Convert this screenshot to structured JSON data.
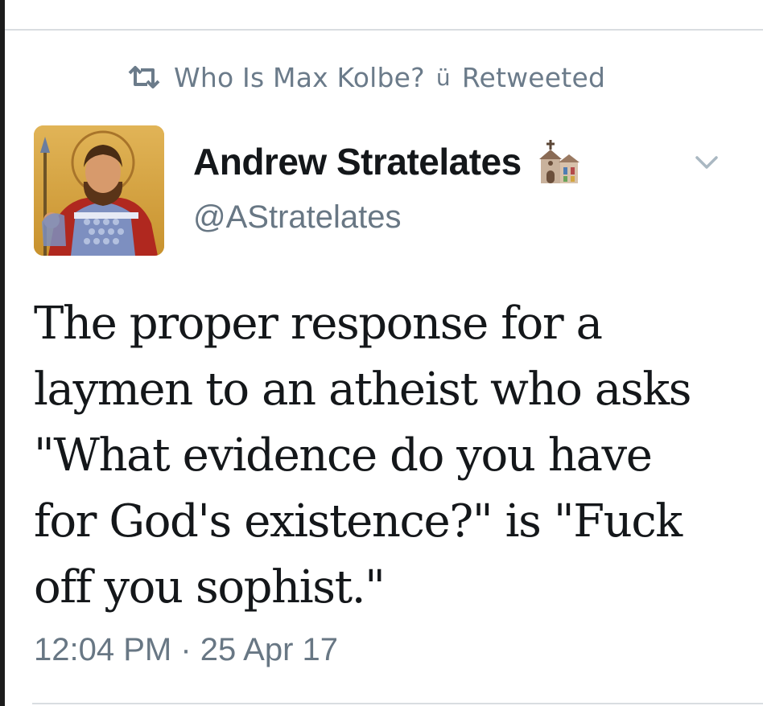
{
  "retweet": {
    "icon": "retweet-icon",
    "user": "Who Is Max Kolbe?",
    "emoji": "ü",
    "label": "Retweeted"
  },
  "tweet": {
    "avatar_icon": "saint-icon-avatar",
    "display_name": "Andrew Stratelates",
    "name_emoji_icon": "church-emoji-icon",
    "handle": "@AStratelates",
    "menu_icon": "chevron-down-icon",
    "text": "The proper response for a\nlaymen to an atheist who asks\n\"What evidence do you have\nfor God's existence?\" is \"Fuck\noff you sophist.\"",
    "timestamp": "12:04 PM · 25 Apr 17"
  },
  "colors": {
    "text": "#14171a",
    "muted": "#687784",
    "divider": "#d9dde1"
  }
}
